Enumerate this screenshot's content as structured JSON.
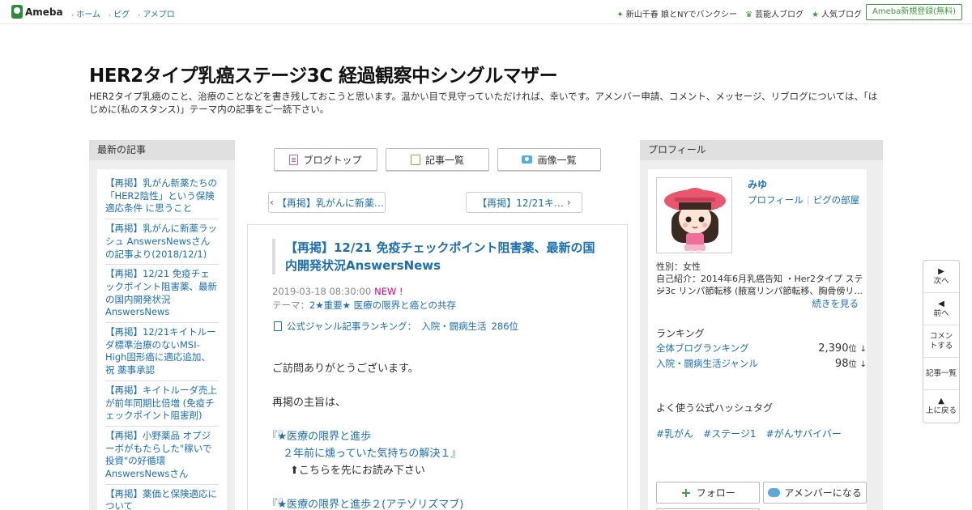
{
  "topbar": {
    "logo": "Ameba",
    "nav": [
      "ホーム",
      "ピグ",
      "アメプロ"
    ],
    "right_links": [
      {
        "icon": "sparkle-icon",
        "label": "新山千春 娘とNYでバンクシー"
      },
      {
        "icon": "crown-icon",
        "label": "芸能人ブログ"
      },
      {
        "icon": "star-icon",
        "label": "人気ブログ"
      }
    ],
    "signup": "Ameba新規登録(無料)"
  },
  "blog": {
    "title": "HER2タイプ乳癌ステージ3C 経過観察中シングルマザー",
    "description": "HER2タイプ乳癌のこと、治療のことなどを書き残しておこうと思います。温かい目で見守っていただければ、幸いです。アメンバー申請、コメント、メッセージ、リブログについては、「はじめに(私のスタンス)」テーマ内の記事をご一読下さい。"
  },
  "recent": {
    "heading": "最新の記事",
    "items": [
      "【再掲】乳がん新薬たちの「HER2陰性」という保険適応条件 に思うこと",
      "【再掲】乳がんに新薬ラッシュ AnswersNewsさんの記事より(2018/12/1)",
      "【再掲】12/21 免疫チェックポイント阻害薬、最新の国内開発状況AnswersNews",
      "【再掲】12/21キイトルーダ標準治療のないMSI-High固形癌に適応追加、祝 薬事承認",
      "【再掲】キイトルーダ売上が前年同期比倍増 (免疫チェックポイント阻害剤)",
      "【再掲】小野薬品 オプジーボがもたらした\"稼いで投資\"の好循環 AnswersNewsさん",
      "【再掲】薬価と保険適応について"
    ]
  },
  "toolbar": {
    "blog_top": "ブログトップ",
    "entry_list": "記事一覧",
    "image_list": "画像一覧"
  },
  "pager": {
    "prev": "【再掲】乳がんに新薬…",
    "next": "【再掲】12/21キ…"
  },
  "article": {
    "title": "【再掲】12/21 免疫チェックポイント阻害薬、最新の国内開発状況AnswersNews",
    "datetime": "2019-03-18 08:30:00",
    "new_badge": "NEW !",
    "theme_label": "テーマ：",
    "theme": "2★重要★ 医療の限界と癌との共存",
    "rank_label": "公式ジャンル記事ランキング：",
    "rank_genre": "入院・闘病生活",
    "rank_value": "286位",
    "lines": [
      "ご訪問ありがとうございます。",
      "再掲の主旨は、",
      "『★医療の限界と進歩",
      "２年前に燻っていた気持ちの解決１』",
      "⬆こちらを先にお読み下さい",
      "『★医療の限界と進歩２(アテゾリズマブ)"
    ]
  },
  "profile": {
    "heading": "プロフィール",
    "name": "みゆ",
    "link_profile": "プロフィール",
    "link_pigg": "ピグの部屋",
    "gender": "性別：女性",
    "intro_1": "自己紹介：2014年6月乳癌告知 ・Her2タイプ ステー",
    "intro_2": "ジ3c リンパ節転移 (腋窩リンパ節転移、胸骨傍リ...",
    "more": "続きを見る",
    "ranking_label": "ランキング",
    "rankings": [
      {
        "label": "全体ブログランキング",
        "value": "2,390",
        "unit": "位",
        "arrow": "↓"
      },
      {
        "label": "入院・闘病生活ジャンル",
        "value": "98",
        "unit": "位",
        "arrow": "↓"
      }
    ],
    "hashtag_label": "よく使う公式ハッシュタグ",
    "hashtags": [
      "#乳がん",
      "#ステージ1",
      "#がんサバイバー"
    ],
    "follow": "フォロー",
    "member": "アメンバーになる"
  },
  "float_nav": {
    "next": "次へ",
    "prev": "前へ",
    "comment": "コメントする",
    "list": "記事一覧",
    "top": "上に戻る"
  }
}
